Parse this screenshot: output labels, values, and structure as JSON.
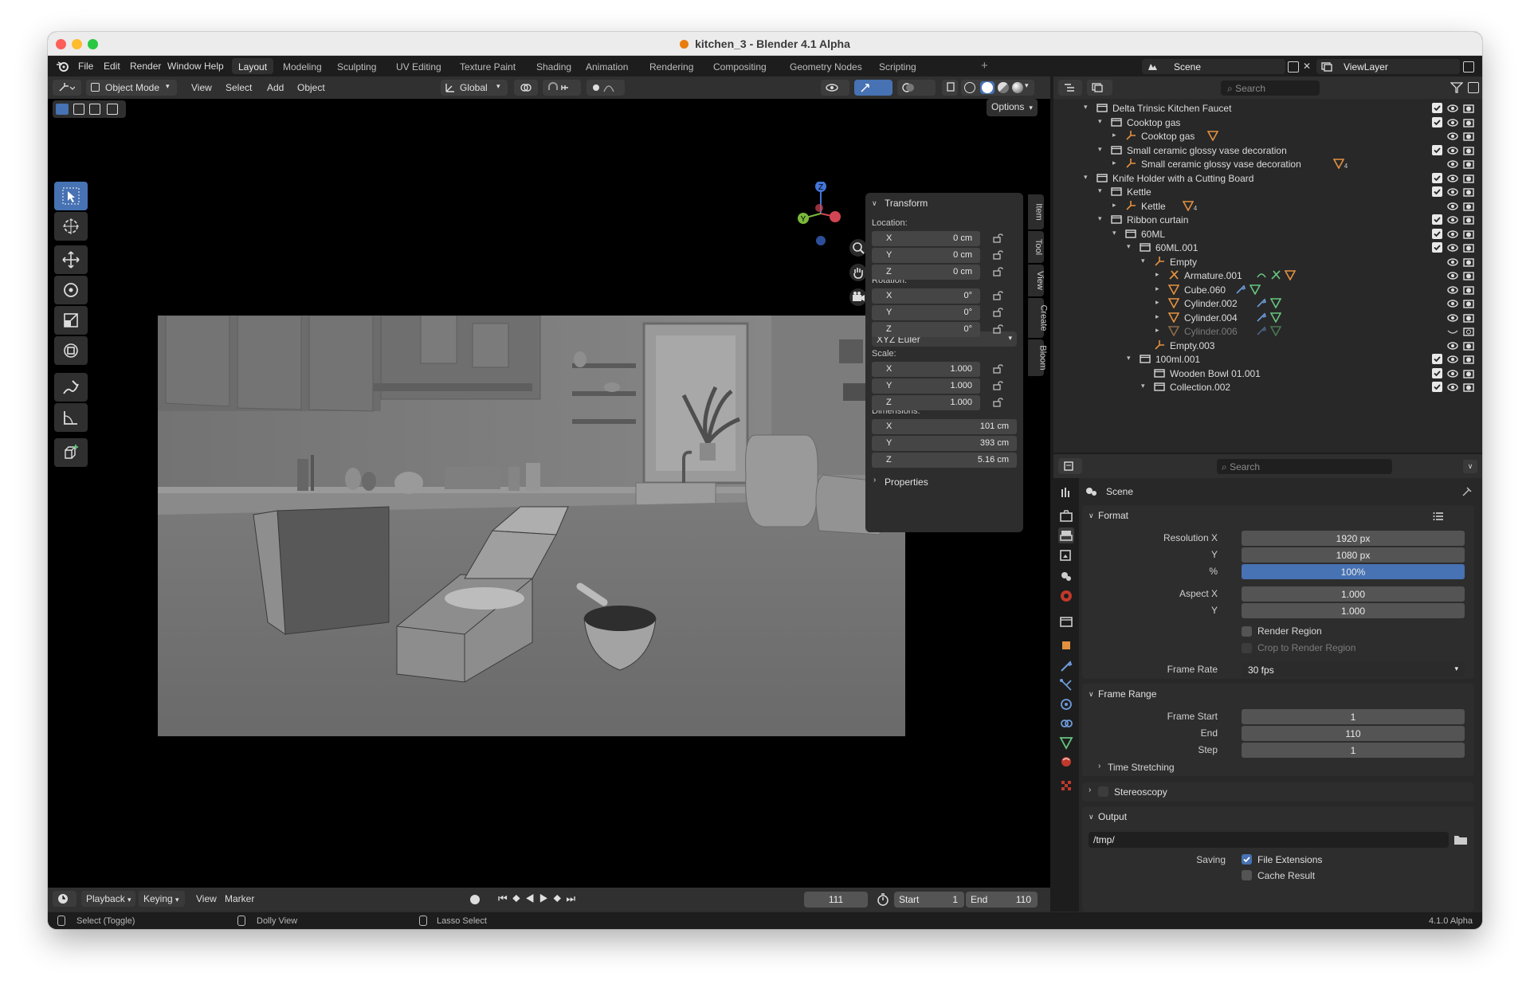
{
  "window": {
    "title": "kitchen_3 - Blender 4.1 Alpha"
  },
  "menubar": {
    "menus": [
      "File",
      "Edit",
      "Render",
      "Window",
      "Help"
    ],
    "workspaces": [
      "Layout",
      "Modeling",
      "Sculpting",
      "UV Editing",
      "Texture Paint",
      "Shading",
      "Animation",
      "Rendering",
      "Compositing",
      "Geometry Nodes",
      "Scripting"
    ],
    "add_tab": "+",
    "scene": "Scene",
    "view_layer": "ViewLayer"
  },
  "viewport_header": {
    "mode": "Object Mode",
    "menus": [
      "View",
      "Select",
      "Add",
      "Object"
    ],
    "transform_orientation": "Global",
    "options": "Options"
  },
  "npanel": {
    "title": "Transform",
    "location_label": "Location:",
    "location": [
      {
        "axis": "X",
        "value": "0 cm"
      },
      {
        "axis": "Y",
        "value": "0 cm"
      },
      {
        "axis": "Z",
        "value": "0 cm"
      }
    ],
    "rotation_label": "Rotation:",
    "rotation": [
      {
        "axis": "X",
        "value": "0°"
      },
      {
        "axis": "Y",
        "value": "0°"
      },
      {
        "axis": "Z",
        "value": "0°"
      }
    ],
    "rotation_mode": "XYZ Euler",
    "scale_label": "Scale:",
    "scale": [
      {
        "axis": "X",
        "value": "1.000"
      },
      {
        "axis": "Y",
        "value": "1.000"
      },
      {
        "axis": "Z",
        "value": "1.000"
      }
    ],
    "dimensions_label": "Dimensions:",
    "dimensions": [
      {
        "axis": "X",
        "value": "101 cm"
      },
      {
        "axis": "Y",
        "value": "393 cm"
      },
      {
        "axis": "Z",
        "value": "5.16 cm"
      }
    ],
    "properties": "Properties",
    "side_tabs": [
      "Item",
      "Tool",
      "View",
      "Create",
      "Bloom"
    ]
  },
  "gizmo": {
    "z": "Z",
    "y": "Y"
  },
  "timeline": {
    "menus": [
      "Playback",
      "Keying",
      "View",
      "Marker"
    ],
    "current_frame": "111",
    "start_label": "Start",
    "start": "1",
    "end_label": "End",
    "end": "110"
  },
  "statusbar": {
    "items": [
      "Select (Toggle)",
      "Dolly View",
      "Lasso Select"
    ],
    "version": "4.1.0 Alpha"
  },
  "outliner": {
    "search_placeholder": "Search",
    "rows": [
      {
        "label": "Delta Trinsic Kitchen Faucet",
        "type": "collection",
        "muted": false
      },
      {
        "label": "Cooktop gas",
        "type": "collection",
        "muted": false
      },
      {
        "label": "Cooktop gas",
        "type": "empty",
        "muted": false
      },
      {
        "label": "Small ceramic glossy vase decoration",
        "type": "collection",
        "muted": false
      },
      {
        "label": "Small ceramic glossy vase decoration",
        "type": "empty",
        "muted": false
      },
      {
        "label": "Knife Holder with a Cutting Board",
        "type": "collection",
        "muted": false
      },
      {
        "label": "Kettle",
        "type": "collection",
        "muted": false
      },
      {
        "label": "Kettle",
        "type": "empty",
        "muted": false
      },
      {
        "label": "Ribbon curtain",
        "type": "collection",
        "muted": false
      },
      {
        "label": "60ML",
        "type": "collection",
        "muted": false
      },
      {
        "label": "60ML.001",
        "type": "collection",
        "muted": false
      },
      {
        "label": "Empty",
        "type": "empty",
        "muted": false
      },
      {
        "label": "Armature.001",
        "type": "armature",
        "muted": false
      },
      {
        "label": "Cube.060",
        "type": "mesh",
        "muted": false
      },
      {
        "label": "Cylinder.002",
        "type": "mesh",
        "muted": false
      },
      {
        "label": "Cylinder.004",
        "type": "mesh",
        "muted": false
      },
      {
        "label": "Cylinder.006",
        "type": "mesh",
        "muted": true
      },
      {
        "label": "Empty.003",
        "type": "empty",
        "muted": false
      },
      {
        "label": "100ml.001",
        "type": "collection",
        "muted": false
      },
      {
        "label": "Wooden Bowl 01.001",
        "type": "collection",
        "muted": false
      },
      {
        "label": "Collection.002",
        "type": "collection",
        "muted": false
      }
    ],
    "badge": "4"
  },
  "properties": {
    "search_placeholder": "Search",
    "context": "Scene",
    "format": {
      "title": "Format",
      "resolution_x_label": "Resolution X",
      "resolution_x": "1920 px",
      "y_label": "Y",
      "resolution_y": "1080 px",
      "pct_label": "%",
      "resolution_pct": "100%",
      "aspect_x_label": "Aspect X",
      "aspect_x": "1.000",
      "aspect_y_label": "Y",
      "aspect_y": "1.000",
      "render_region": "Render Region",
      "crop_region": "Crop to Render Region",
      "frame_rate_label": "Frame Rate",
      "frame_rate": "30 fps"
    },
    "frame_range": {
      "title": "Frame Range",
      "start_label": "Frame Start",
      "start": "1",
      "end_label": "End",
      "end": "110",
      "step_label": "Step",
      "step": "1"
    },
    "time_stretching": "Time Stretching",
    "stereoscopy": "Stereoscopy",
    "output": {
      "title": "Output",
      "path": "/tmp/",
      "saving_label": "Saving",
      "file_extensions": "File Extensions",
      "cache_result": "Cache Result"
    }
  },
  "colors": {
    "accent": "#4772b3",
    "orange": "#e3913f",
    "green": "#68c57f",
    "blue": "#6e9cdc"
  }
}
